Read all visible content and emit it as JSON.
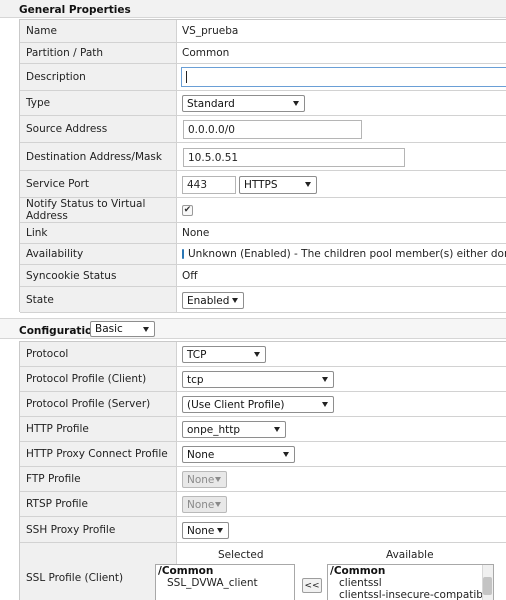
{
  "general": {
    "title": "General Properties",
    "name": {
      "label": "Name",
      "value": "VS_prueba"
    },
    "partition": {
      "label": "Partition / Path",
      "value": "Common"
    },
    "description": {
      "label": "Description",
      "value": ""
    },
    "type": {
      "label": "Type",
      "value": "Standard"
    },
    "source": {
      "label": "Source Address",
      "value": "0.0.0.0/0"
    },
    "destination": {
      "label": "Destination Address/Mask",
      "value": "10.5.0.51"
    },
    "service_port": {
      "label": "Service Port",
      "port": "443",
      "protocol": "HTTPS"
    },
    "notify": {
      "label": "Notify Status to Virtual Address",
      "checked": "✔"
    },
    "link": {
      "label": "Link",
      "value": "None"
    },
    "availability": {
      "label": "Availability",
      "value": "Unknown (Enabled) - The children pool member(s) either don't have"
    },
    "syncookie": {
      "label": "Syncookie Status",
      "value": "Off"
    },
    "state": {
      "label": "State",
      "value": "Enabled"
    }
  },
  "configuration": {
    "title": "Configuration:",
    "mode": "Basic",
    "protocol": {
      "label": "Protocol",
      "value": "TCP"
    },
    "profile_client": {
      "label": "Protocol Profile (Client)",
      "value": "tcp"
    },
    "profile_server": {
      "label": "Protocol Profile (Server)",
      "value": "(Use Client Profile)"
    },
    "http_profile": {
      "label": "HTTP Profile",
      "value": "onpe_http"
    },
    "http_proxy": {
      "label": "HTTP Proxy Connect Profile",
      "value": "None"
    },
    "ftp_profile": {
      "label": "FTP Profile",
      "value": "None"
    },
    "rtsp_profile": {
      "label": "RTSP Profile",
      "value": "None"
    },
    "ssh_proxy": {
      "label": "SSH Proxy Profile",
      "value": "None"
    },
    "ssl_client": {
      "label": "SSL Profile (Client)",
      "selected_title": "Selected",
      "available_title": "Available",
      "selected_group": "/Common",
      "selected_items": [
        "SSL_DVWA_client"
      ],
      "available_group": "/Common",
      "available_items": [
        "clientssl",
        "clientssl-insecure-compatible"
      ],
      "move_left_label": "<<"
    }
  },
  "colors": {
    "status_blue": "#3f95db",
    "label_bg": "#f0f0f0"
  },
  "icons": {
    "status": "status-square-blue-icon",
    "check": "checkmark-icon"
  }
}
